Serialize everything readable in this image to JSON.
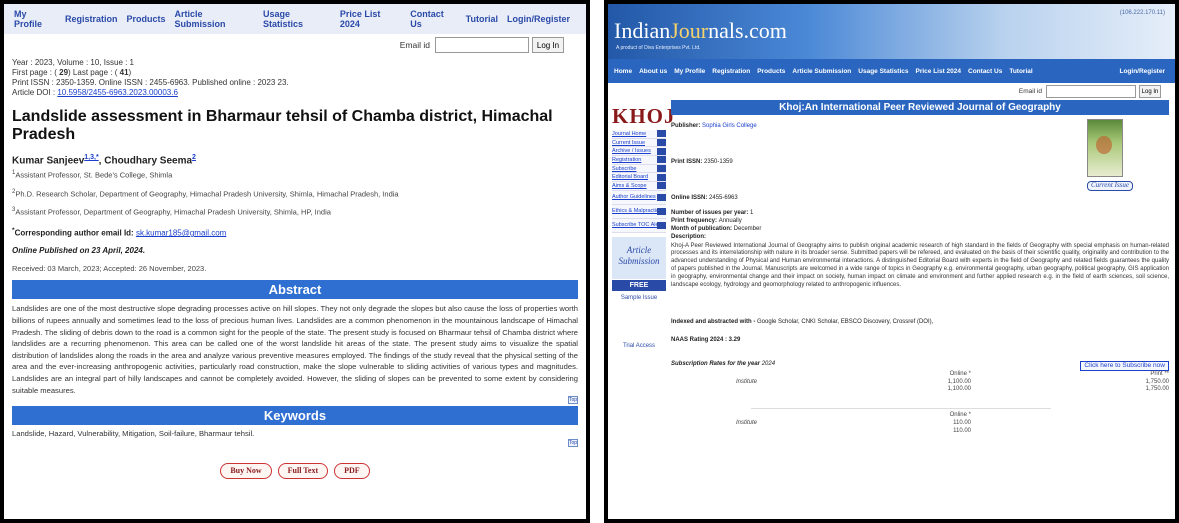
{
  "left": {
    "nav": {
      "items": [
        "My Profile",
        "Registration",
        "Products",
        "Article Submission",
        "Usage Statistics",
        "Price List 2024",
        "Contact Us",
        "Tutorial"
      ],
      "login": "Login/Register"
    },
    "email": {
      "label": "Email id",
      "value": "",
      "button": "Log In"
    },
    "meta": {
      "line1": "Year : 2023, Volume : 10, Issue : 1",
      "line2": "First page : ( 29) Last page : ( 41)",
      "line3": "Print ISSN : 2350-1359. Online ISSN : 2455-6963. Published online : 2023  23.",
      "doi_label": "Article DOI : ",
      "doi": "10.5958/2455-6963.2023.00003.6"
    },
    "title": "Landslide assessment in Bharmaur tehsil of Chamba district, Himachal Pradesh",
    "authors": {
      "a1": "Kumar Sanjeev",
      "a1_sup": "1,3,*",
      "sep": ", ",
      "a2": "Choudhary Seema",
      "a2_sup": "2"
    },
    "affiliations": [
      {
        "sup": "1",
        "text": "Assistant Professor, St. Bede's College, Shimla"
      },
      {
        "sup": "2",
        "text": "Ph.D. Research Scholar, Department of Geography, Himachal Pradesh University, Shimla, Himachal Pradesh, India"
      },
      {
        "sup": "3",
        "text": "Assistant Professor, Department of Geography, Himachal Pradesh University, Shimla, HP, India"
      }
    ],
    "corresponding": {
      "sup": "*",
      "label": "Corresponding author email Id: ",
      "email": "sk.kumar185@gmail.com"
    },
    "published": "Online Published on 23 April, 2024.",
    "received": "Received:  03  March,  2023; Accepted:  26  November,  2023.",
    "abstract_heading": "Abstract",
    "abstract": "Landslides are one of the most destructive slope degrading processes active on hill slopes. They not only degrade the slopes but also cause the loss of properties worth billions of rupees annually and sometimes lead to the loss of precious human lives. Landslides are a common phenomenon in the mountainous landscape of Himachal Pradesh. The sliding of debris down to the road is a common sight for the people of the state. The present study is focused on Bharmaur tehsil of Chamba district where landslides are a recurring phenomenon. This area can be called one of the worst landslide hit areas of the state. The present study aims to visualize the spatial distribution of landslides along the roads in the area and analyze various preventive measures employed. The findings of the study reveal that the physical setting of the area and the ever-increasing anthropogenic activities, particularly road construction, make the slope vulnerable to sliding activities of various types and magnitudes. Landslides are an integral part of hilly landscapes and cannot be completely avoided. However, the sliding of slopes can be prevented to some extent by considering suitable measures.",
    "top_label": "Top",
    "keywords_heading": "Keywords",
    "keywords": "Landslide, Hazard, Vulnerability, Mitigation, Soil-failure, Bharmaur tehsil.",
    "buttons": {
      "buy": "Buy Now",
      "full": "Full Text",
      "pdf": "PDF"
    }
  },
  "right": {
    "header": {
      "logo_main": "Indian",
      "logo_j": "Jour",
      "logo_end": "nals.com",
      "logo_sub": "A product of Diva Enterprises Pvt. Ltd.",
      "ip": "(106.222.170.11)"
    },
    "nav": {
      "items": [
        "Home",
        "About us",
        "My Profile",
        "Registration",
        "Products",
        "Article Submission",
        "Usage Statistics",
        "Price List 2024",
        "Contact Us",
        "Tutorial"
      ],
      "login": "Login/Register"
    },
    "email": {
      "label": "Email id",
      "value": "",
      "button": "Log In"
    },
    "sidebar": {
      "logo": "KHOJ",
      "items": [
        "Journal Home",
        "Current Issue",
        "Archive / Issues",
        "Registration",
        "Subscribe",
        "Editorial Board",
        "Aims & Scope",
        "Author Guidelines",
        "Ethics & Malpractice",
        "Subscribe TOC Alerts"
      ],
      "article_submission": "Article Submission",
      "free": "FREE",
      "sample_issue": "Sample Issue",
      "trial_access": "Trial Access"
    },
    "title": "Khoj:An International Peer Reviewed Journal of Geography",
    "publisher_label": "Publisher: ",
    "publisher": "Sophia Girls College",
    "print_issn_label": "Print ISSN: ",
    "print_issn": "2350-1359",
    "online_issn_label": "Online ISSN: ",
    "online_issn": "2455-6963",
    "current_issue_btn": "Current Issue",
    "issues_label": "Number of issues per year: ",
    "issues": "1",
    "frequency_label": "Print frequency: ",
    "frequency": "Annually",
    "month_label": "Month of publication: ",
    "month": "December",
    "description_label": "Description:",
    "description": "Khoj-A Peer Reviewed International Journal of Geography aims to publish original academic research of high standard in the fields of Geography with special emphasis on human-related processes and its interrelationship with nature in its broader sense. Submitted papers will be refereed, and evaluated on the basis of their scientific quality, originality and contribution to the advanced understanding of Physical and Human environmental interactions. A distinguished Editorial Board with experts in the field of Geography and related fields guarantees the quality of papers published in the Journal. Manuscripts are welcomed in a wide range of topics in Geography e.g. environmental geography, urban geography, political geography, GIS application in geography, environmental change and their impact on society, human impact on climate and environment and further applied research e.g. in the field of earth sciences, soil science, landscape ecology, hydrology and geomorphology related to anthropogenic influences.",
    "indexed_label": "Indexed and abstracted with - ",
    "indexed": "Google Scholar, CNKI Scholar, EBSCO Discovery, Crossref (DOI),",
    "naas": "NAAS Rating 2024 : 3.29",
    "subscription_label": "Subscription Rates for the year",
    "subscription_year": "2024",
    "subscribe_btn": "Click here to Subscribe now",
    "rates_block1": {
      "online_head": "Online *",
      "print_head": "Print **",
      "row_label": "Institute",
      "online": [
        "1,100.00",
        "1,100.00"
      ],
      "print": [
        "1,750.00",
        "1,750.00"
      ]
    },
    "rates_block2": {
      "online_head": "Online *",
      "row_label": "Institute",
      "online": [
        "110.00",
        "110.00"
      ]
    }
  }
}
